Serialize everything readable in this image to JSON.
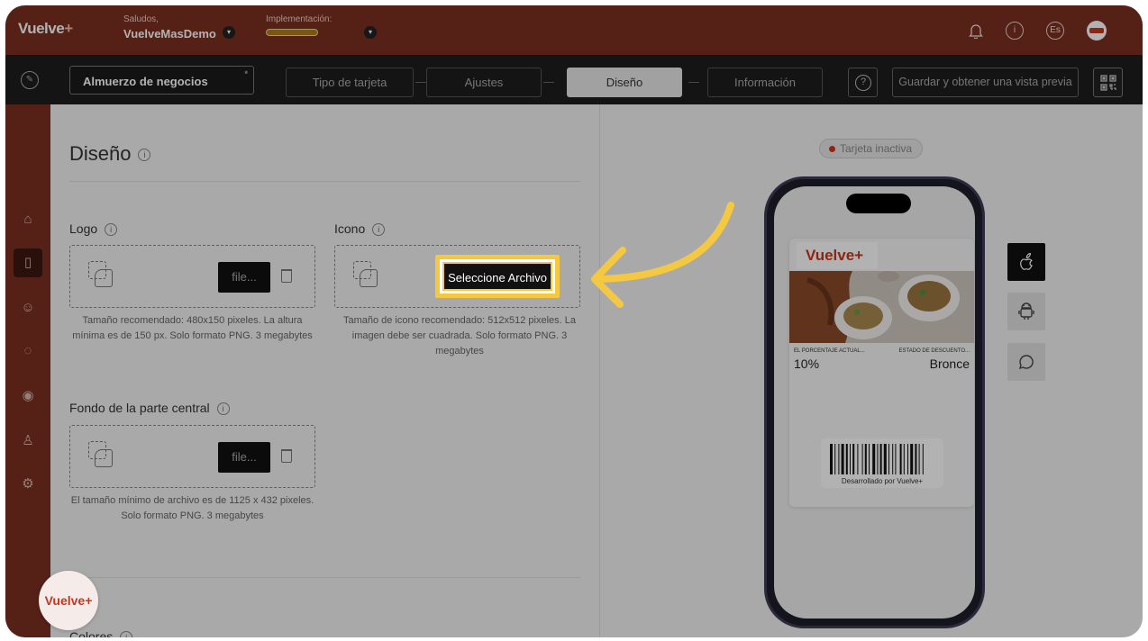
{
  "topbar": {
    "brand_main": "Vuelve",
    "brand_plus": "+",
    "greeting_label": "Saludos,",
    "user_name": "VuelveMasDemo",
    "implementation_label": "Implementación:",
    "lang": "Es",
    "info": "i"
  },
  "navbar": {
    "card_name": "Almuerzo de negocios",
    "required_mark": "*",
    "tabs": [
      {
        "label": "Tipo de tarjeta"
      },
      {
        "label": "Ajustes"
      },
      {
        "label": "Diseño"
      },
      {
        "label": "Información"
      }
    ],
    "active_tab": "Diseño",
    "help": "?",
    "save_label": "Guardar y obtener una vista previa"
  },
  "design": {
    "title": "Diseño",
    "info": "i",
    "logo": {
      "label": "Logo",
      "button": "file...",
      "help": "Tamaño recomendado: 480x150 pixeles. La altura mínima es de 150 px. Solo formato PNG. 3 megabytes"
    },
    "icon": {
      "label": "Icono",
      "button": "Seleccione Archivo",
      "help": "Tamaño de icono recomendado: 512x512 pixeles. La imagen debe ser cuadrada. Solo formato PNG. 3 megabytes"
    },
    "background": {
      "label": "Fondo de la parte central",
      "button": "file...",
      "help": "El tamaño mínimo de archivo es de 1125 x 432 pixeles. Solo formato PNG. 3 megabytes"
    },
    "colors_label": "Colores"
  },
  "preview": {
    "status": "Tarjeta inactiva",
    "pass_logo": "Vuelve+",
    "field1_label": "EL PORCENTAJE ACTUAL...",
    "field1_value": "10%",
    "field2_label": "ESTADO DE DESCUENTO...",
    "field2_value": "Bronce",
    "barcode_caption": "Desarrollado por Vuelve+"
  },
  "fab": {
    "label": "Vuelve+"
  },
  "colors": {
    "brand": "#7a2e1f",
    "accent": "#c7351e",
    "highlight": "#f5c842",
    "nav_bg": "#1d1d1d"
  }
}
